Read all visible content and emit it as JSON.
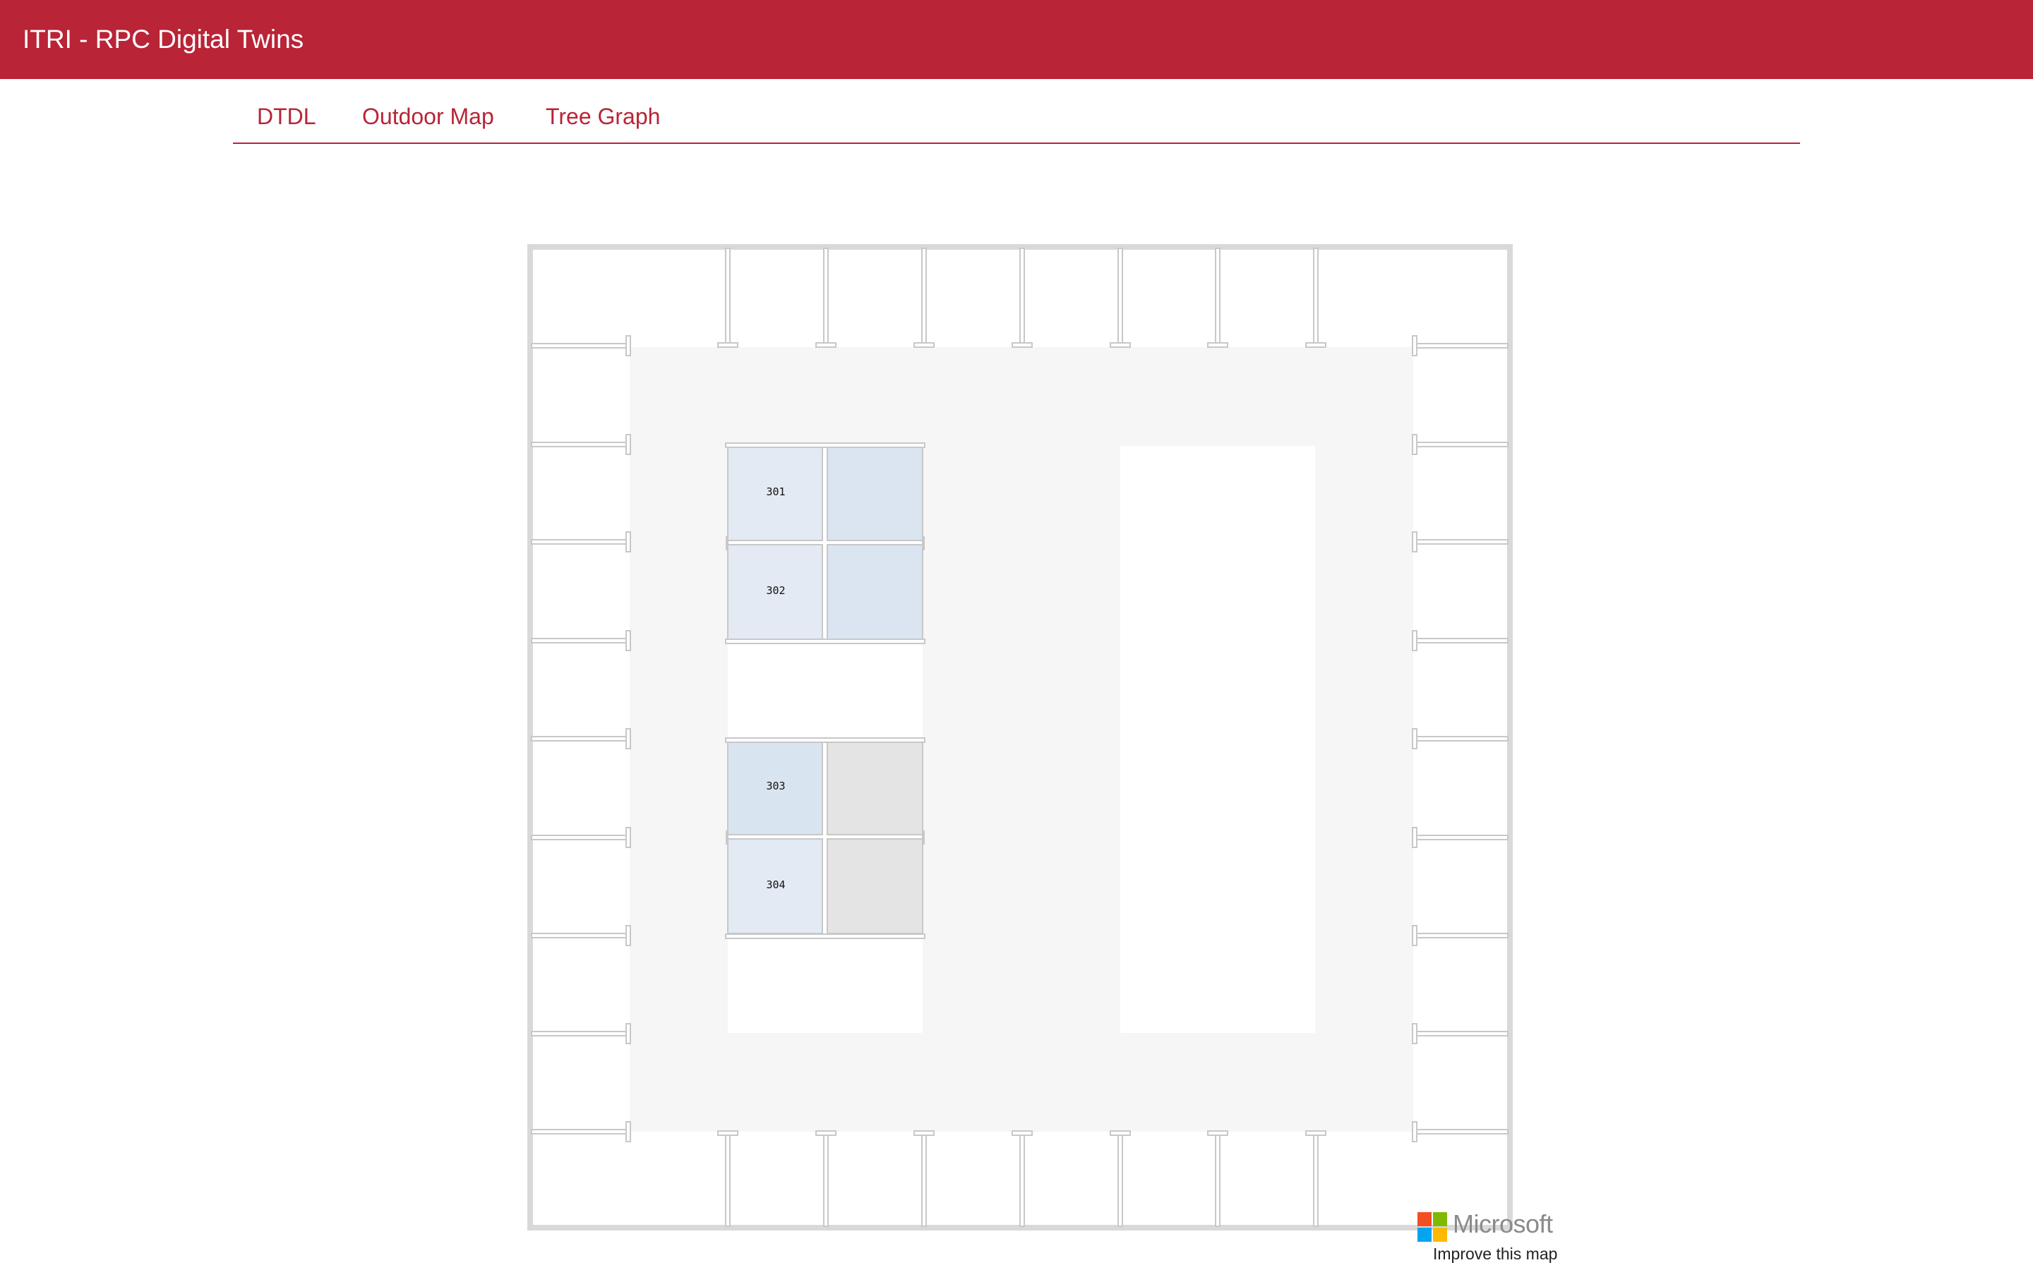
{
  "app": {
    "title": "ITRI - RPC Digital Twins"
  },
  "tabs": [
    {
      "label": "DTDL"
    },
    {
      "label": "Outdoor Map"
    },
    {
      "label": "Tree Graph"
    }
  ],
  "map": {
    "rooms": [
      {
        "label": "301",
        "status_color": "#e3eaf4"
      },
      {
        "label": "302",
        "status_color": "#e3eaf4"
      },
      {
        "label": "303",
        "status_color": "#d9e4f1"
      },
      {
        "label": "304",
        "status_color": "#e3eaf4"
      }
    ],
    "adjacent_room_colors": [
      "#dae5f1",
      "#dae5f1",
      "#e4e4e4",
      "#e4e4e4"
    ],
    "colors": {
      "corridor": "#f6f6f6",
      "wall": "#d9d9d9",
      "partition": "#c8c8c8",
      "background": "#ffffff"
    }
  },
  "attribution": {
    "brand": "Microsoft",
    "improve_link": "Improve this map",
    "logo_colors": [
      "#f25022",
      "#7fba00",
      "#00a4ef",
      "#ffb900"
    ]
  },
  "theme": {
    "accent": "#b92436"
  }
}
